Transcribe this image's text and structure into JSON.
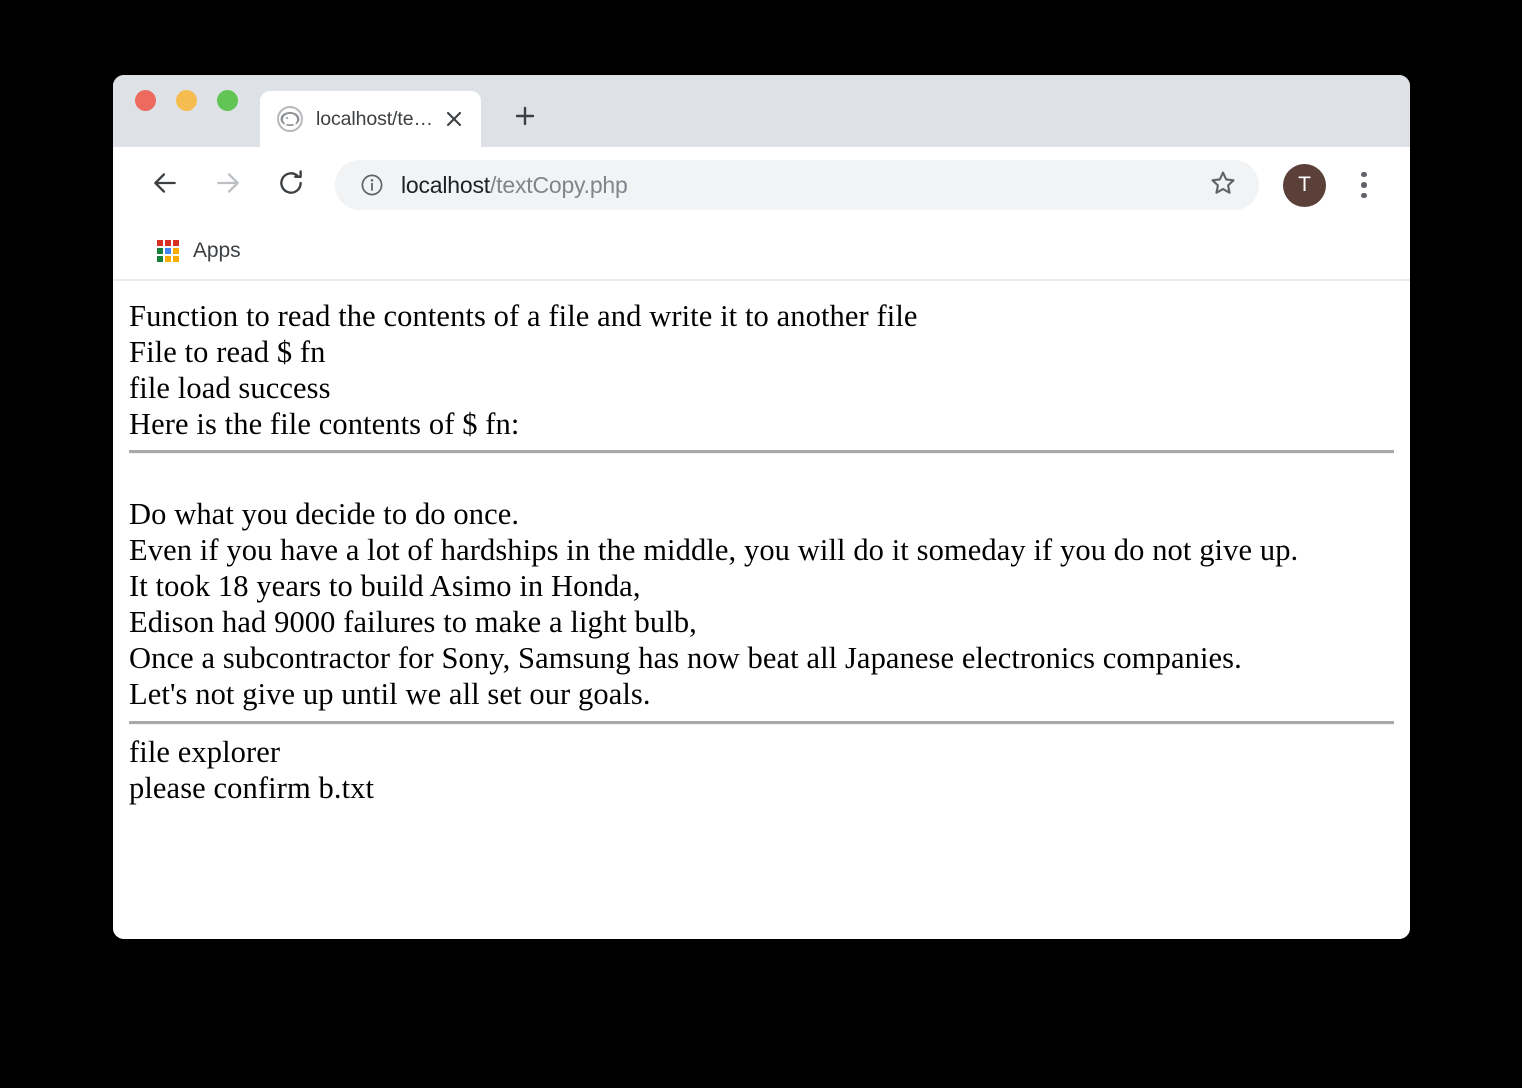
{
  "window": {
    "traffic_lights": [
      {
        "name": "close",
        "color": "#ec6a5e"
      },
      {
        "name": "minimize",
        "color": "#f5bd4f"
      },
      {
        "name": "maximize",
        "color": "#61c454"
      }
    ]
  },
  "tabstrip": {
    "tab_title": "localhost/textCopy.php",
    "favicon": "php-elephant-icon",
    "close_icon": "close-icon",
    "new_tab_icon": "plus-icon"
  },
  "toolbar": {
    "back_icon": "arrow-left-icon",
    "forward_icon": "arrow-right-icon",
    "reload_icon": "reload-icon",
    "info_icon": "info-circle-icon",
    "url_host": "localhost",
    "url_path": "/textCopy.php",
    "bookmark_icon": "star-icon",
    "avatar_initial": "T",
    "avatar_color": "#5a4039",
    "menu_icon": "three-dots-vertical-icon"
  },
  "bookmarks_bar": {
    "items": [
      {
        "label": "Apps",
        "icon": "apps-grid-icon"
      }
    ],
    "apps_colors": [
      "#d93025",
      "#d93025",
      "#d93025",
      "#188038",
      "#4285f4",
      "#f9ab00",
      "#188038",
      "#f9ab00",
      "#f9ab00"
    ]
  },
  "content": {
    "header_block": "Function to read the contents of a file and write it to another file\nFile to read $ fn\nfile load success\nHere is the file contents of $ fn:",
    "file_contents_block": "\nDo what you decide to do once.\nEven if you have a lot of hardships in the middle, you will do it someday if you do not give up.\nIt took 18 years to build Asimo in Honda,\nEdison had 9000 failures to make a light bulb,\nOnce a subcontractor for Sony, Samsung has now beat all Japanese electronics companies.\nLet's not give up until we all set our goals.",
    "footer_block": "file explorer\nplease confirm b.txt"
  }
}
